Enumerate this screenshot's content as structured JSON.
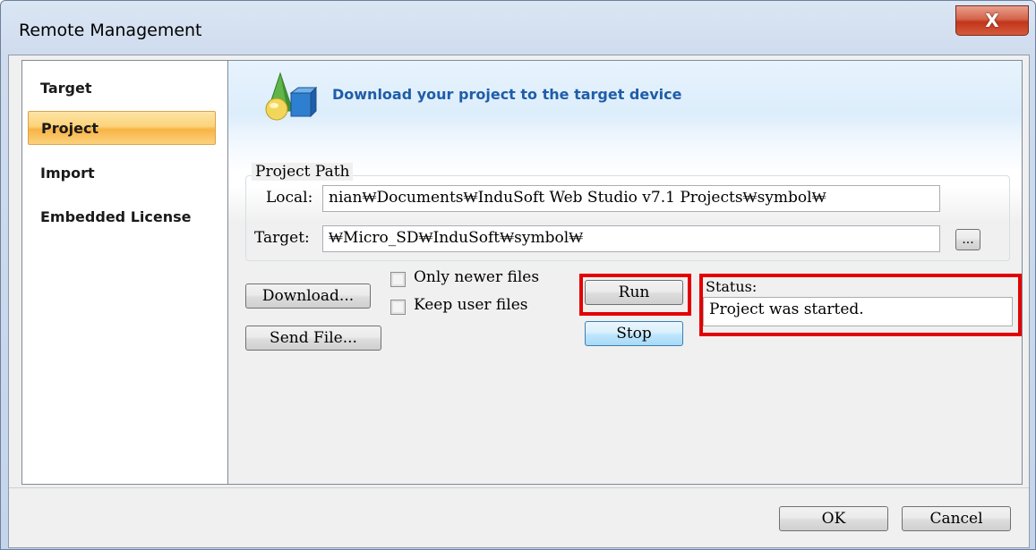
{
  "window": {
    "title": "Remote Management",
    "close_label": "X"
  },
  "nav": {
    "items": [
      {
        "label": "Target",
        "selected": false
      },
      {
        "label": "Project",
        "selected": true
      },
      {
        "label": "Import",
        "selected": false
      },
      {
        "label": "Embedded License",
        "selected": false
      }
    ]
  },
  "header": {
    "icon": "shapes-icon",
    "text": "Download your project to the target device"
  },
  "project_path": {
    "group_label": "Project Path",
    "local_label": "Local:",
    "local_value": "nian₩Documents₩InduSoft Web Studio v7.1 Projects₩symbol₩",
    "target_label": "Target:",
    "target_value": "₩Micro_SD₩InduSoft₩symbol₩",
    "browse_label": "..."
  },
  "actions": {
    "download_label": "Download...",
    "send_file_label": "Send File...",
    "only_newer_label": "Only newer files",
    "only_newer_checked": false,
    "keep_user_label": "Keep user files",
    "keep_user_checked": false,
    "run_label": "Run",
    "stop_label": "Stop"
  },
  "status": {
    "label": "Status:",
    "value": "Project was started."
  },
  "footer": {
    "ok_label": "OK",
    "cancel_label": "Cancel"
  },
  "colors": {
    "highlight": "#e30000",
    "header_text": "#1f5da8",
    "nav_selected": "#f8b446"
  }
}
